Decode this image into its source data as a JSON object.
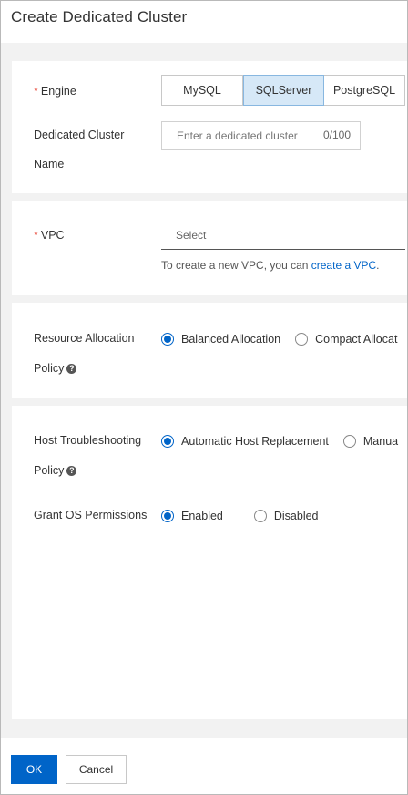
{
  "dialog": {
    "title": "Create Dedicated Cluster"
  },
  "engine": {
    "label": "Engine",
    "required_mark": "*",
    "options": [
      "MySQL",
      "SQLServer",
      "PostgreSQL"
    ],
    "selected": "SQLServer"
  },
  "cluster_name": {
    "label_line1": "Dedicated Cluster",
    "label_line2": "Name",
    "placeholder": "Enter a dedicated cluster",
    "value": "",
    "counter": "0/100"
  },
  "vpc": {
    "label": "VPC",
    "required_mark": "*",
    "placeholder": "Select",
    "hint_prefix": "To create a new VPC, you can ",
    "hint_link": "create a VPC",
    "hint_suffix": "."
  },
  "resource_allocation": {
    "label_line1": "Resource Allocation",
    "label_line2": "Policy",
    "options": [
      "Balanced Allocation",
      "Compact Allocat"
    ],
    "selected": "Balanced Allocation"
  },
  "host_troubleshooting": {
    "label_line1": "Host Troubleshooting",
    "label_line2": "Policy",
    "options": [
      "Automatic Host Replacement",
      "Manua"
    ],
    "selected": "Automatic Host Replacement"
  },
  "grant_os": {
    "label": "Grant OS Permissions",
    "options": [
      "Enabled",
      "Disabled"
    ],
    "selected": "Enabled"
  },
  "footer": {
    "ok_label": "OK",
    "cancel_label": "Cancel"
  },
  "colors": {
    "primary": "#0064c8",
    "required": "#e84738",
    "selected_segment_bg": "#d6e8f7"
  },
  "icons": {
    "help": "question-circle-icon"
  }
}
